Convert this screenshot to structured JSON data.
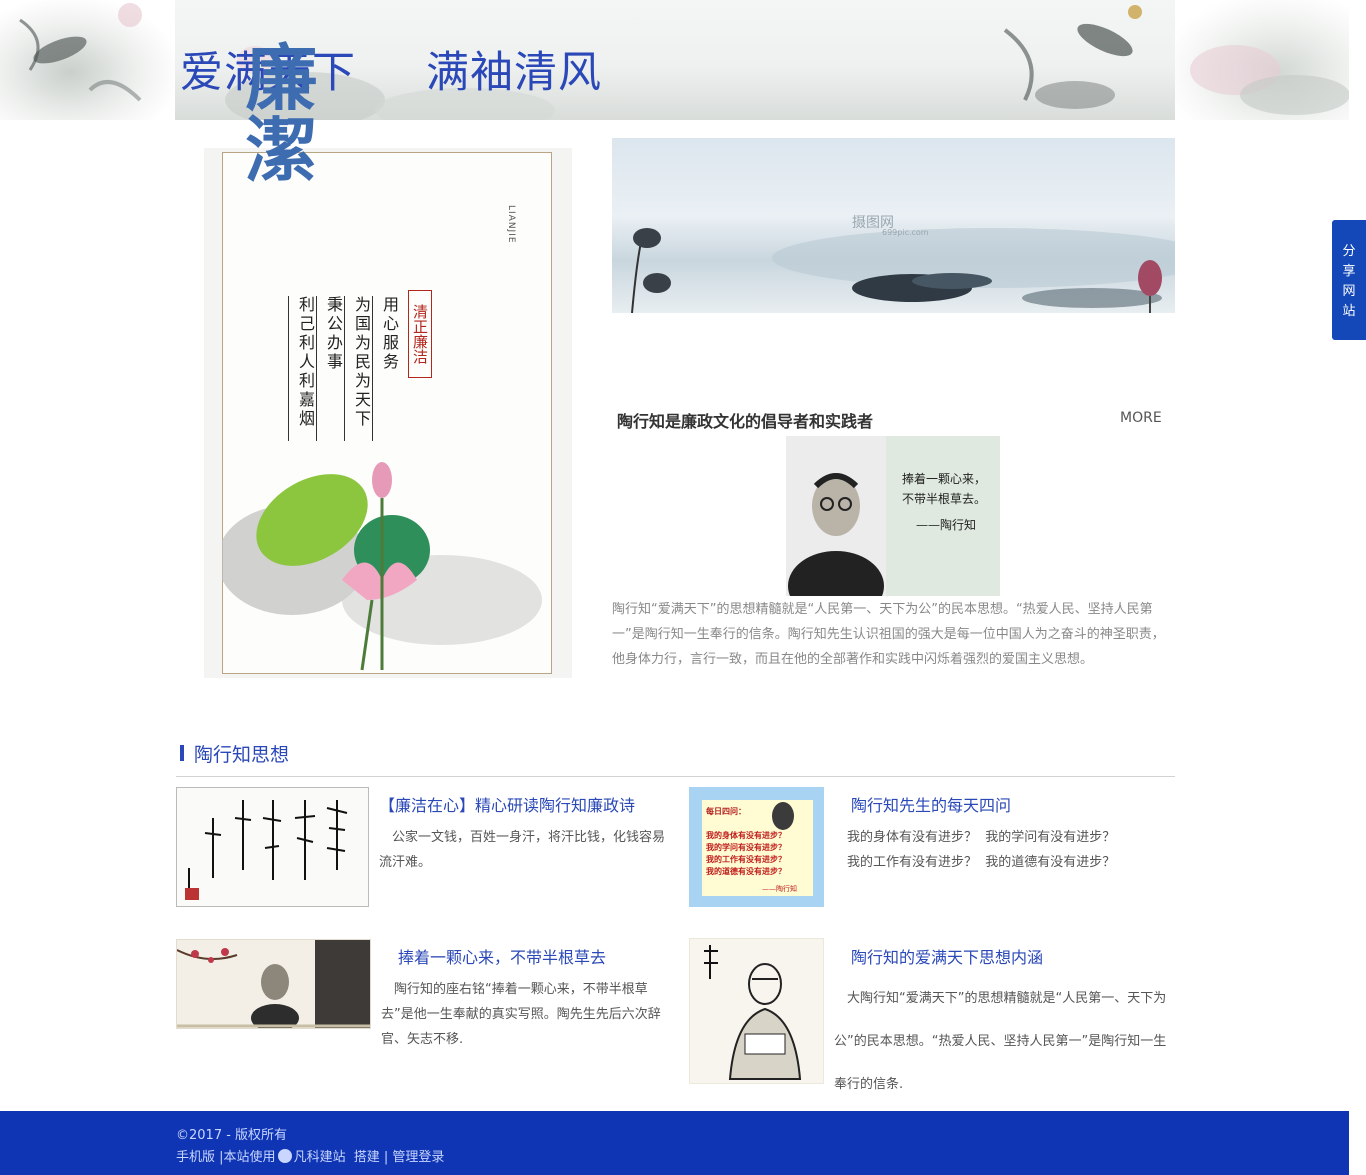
{
  "header": {
    "title_left": "爱满天下",
    "title_right": "满袖清风"
  },
  "share_tab": [
    "分",
    "享",
    "网",
    "站"
  ],
  "poster": {
    "title": "廉潔",
    "pinyin": "LIANJIE",
    "subtitle": "清正廉洁",
    "lines": [
      "用心服务",
      "为国为民为天下",
      "秉公办事",
      "利己利人利嘉烟"
    ]
  },
  "banner": {
    "watermark": "摄图网",
    "watermark_sub": "699pic.com"
  },
  "feature": {
    "title": "陶行知是廉政文化的倡导者和实践者",
    "more": "MORE",
    "image_quote_line1": "捧着一颗心来，",
    "image_quote_line2": "不带半根草去。",
    "image_quote_author": "——陶行知",
    "text": "陶行知“爱满天下”的思想精髓就是“人民第一、天下为公”的民本思想。“热爱人民、坚持人民第一”是陶行知一生奉行的信条。陶行知先生认识祖国的强大是每一位中国人为之奋斗的神圣职责，他身体力行，言行一致，而且在他的全部著作和实践中闪烁着强烈的爱国主义思想。"
  },
  "section": {
    "title": "陶行知思想"
  },
  "cards": [
    {
      "title": "【廉洁在心】精心研读陶行知廉政诗",
      "text": "公家一文钱，百姓一身汗，将汗比钱，化钱容易流汗难。"
    },
    {
      "title": "陶行知先生的每天四问",
      "line1": "我的身体有没有进步？  我的学问有没有进步？",
      "line2": "我的工作有没有进步？  我的道德有没有进步？",
      "image_heading": "每日四问：",
      "image_lines": [
        "我的身体有没有进步？",
        "我的学问有没有进步？",
        "我的工作有没有进步？",
        "我的道德有没有进步？"
      ],
      "image_author": "——陶行知"
    },
    {
      "title": "捧着一颗心来，不带半根草去",
      "text": "陶行知的座右铭“捧着一颗心来，不带半根草去”是他一生奉献的真实写照。陶先生先后六次辞官、矢志不移."
    },
    {
      "title": "陶行知的爱满天下思想内涵",
      "text": "大陶行知“爱满天下”的思想精髓就是“人民第一、天下为公”的民本思想。“热爱人民、坚持人民第一”是陶行知一生奉行的信条."
    }
  ],
  "footer": {
    "copyright": "©2017 - 版权所有",
    "mobile": "手机版",
    "sep": "|",
    "using_prefix": "本站使用",
    "builder": "凡科建站",
    "build": "搭建",
    "admin": "管理登录"
  }
}
